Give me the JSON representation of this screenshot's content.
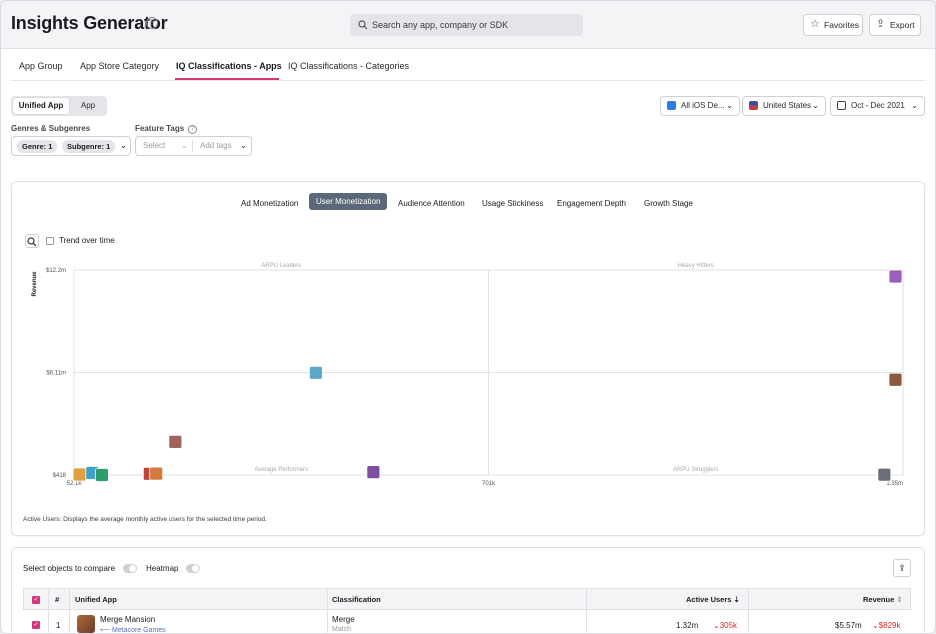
{
  "header": {
    "title": "Insights Generator",
    "search_placeholder": "Search any app, company or SDK",
    "favorites_label": "Favorites",
    "export_label": "Export"
  },
  "tabs": [
    {
      "label": "App Group"
    },
    {
      "label": "App Store Category"
    },
    {
      "label": "IQ Classifications - Apps",
      "active": true
    },
    {
      "label": "IQ Classifications - Categories"
    }
  ],
  "view_toggle": {
    "unified": "Unified App",
    "app": "App"
  },
  "filters": {
    "device": "All iOS De...",
    "country": "United States",
    "date_range": "Oct - Dec 2021",
    "genres_label": "Genres & Subgenres",
    "genre_pill": "Genre: 1",
    "subgenre_pill": "Subgenre: 1",
    "feature_tags_label": "Feature Tags",
    "select_placeholder": "Select",
    "add_tags_placeholder": "Add tags"
  },
  "chart_tabs": [
    {
      "label": "Ad Monetization"
    },
    {
      "label": "User Monetization",
      "active": true
    },
    {
      "label": "Audience Attention"
    },
    {
      "label": "Usage Stickiness"
    },
    {
      "label": "Engagement Depth"
    },
    {
      "label": "Growth Stage"
    }
  ],
  "trend_label": "Trend over time",
  "chart_data": {
    "type": "scatter",
    "xlabel": "Active Users",
    "ylabel": "Revenue",
    "x_ticks": [
      "52.1k",
      "701k",
      "1.35m"
    ],
    "y_ticks": [
      "$418",
      "$6.11m",
      "$12.2m"
    ],
    "xlim": [
      52100,
      1350000
    ],
    "ylim": [
      418,
      12200000
    ],
    "quadrants": [
      "ARPU Leaders",
      "Heavy Hitters",
      "Average Performers",
      "ARPU Strugglers"
    ],
    "points": [
      {
        "x": 1350000,
        "y": 12200000,
        "color": "#9b5fb5"
      },
      {
        "x": 1350000,
        "y": 5700000,
        "color": "#8b5a3c"
      },
      {
        "x": 1320000,
        "y": 50000,
        "color": "#6a6f7a"
      },
      {
        "x": 430000,
        "y": 6110000,
        "color": "#5aa9c9"
      },
      {
        "x": 520000,
        "y": 200000,
        "color": "#7d4fa0"
      },
      {
        "x": 210000,
        "y": 2000000,
        "color": "#a0645a"
      },
      {
        "x": 170000,
        "y": 100000,
        "color": "#c0453c"
      },
      {
        "x": 180000,
        "y": 110000,
        "color": "#d47a3a"
      },
      {
        "x": 60000,
        "y": 60000,
        "color": "#e0a040"
      },
      {
        "x": 80000,
        "y": 150000,
        "color": "#3fa0c8"
      },
      {
        "x": 95000,
        "y": 30000,
        "color": "#2e9d6b"
      }
    ],
    "grid": false
  },
  "footnote": "Active Users: Displays the average monthly active users for the selected time period.",
  "table_controls": {
    "compare_label": "Select objects to compare",
    "heatmap_label": "Heatmap"
  },
  "table": {
    "columns": [
      "#",
      "Unified App",
      "Classification",
      "Active Users",
      "Revenue"
    ],
    "rows": [
      {
        "rank": "1",
        "app": "Merge Mansion",
        "publisher": "Metacore Games",
        "classification": "Merge",
        "sub_classification": "Match",
        "active_users": "1.32m",
        "active_users_delta": "305k",
        "revenue": "$5.57m",
        "revenue_delta": "$829k"
      }
    ]
  },
  "colors": {
    "accent": "#d6357a",
    "tab_active_bg": "#5c6779",
    "negative": "#d92d2d"
  }
}
